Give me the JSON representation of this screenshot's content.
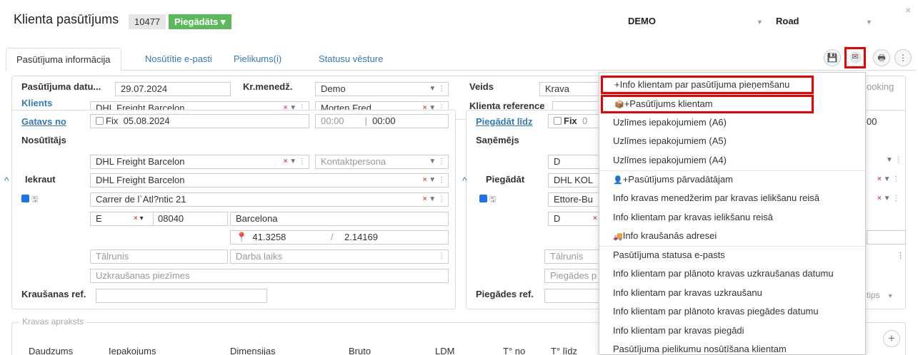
{
  "header": {
    "title": "Klienta pasūtījums",
    "order_number": "10477",
    "status": "Piegādāts ▾",
    "select1": "DEMO",
    "select2": "Road",
    "close": "×"
  },
  "tabs": [
    "Pasūtījuma informācija",
    "Nosūtītie e-pasti",
    "Pielikums(i)",
    "Statusu vēsture"
  ],
  "toolbar": {
    "save": "💾",
    "mail": "✉",
    "print": "🖶",
    "more": "⋮"
  },
  "top": {
    "date_label": "Pasūtījuma datu...",
    "date_value": "29.07.2024",
    "kr_label": "Kr.menedž.",
    "kr_value": "Demo",
    "veids_label": "Veids",
    "veids_value": "Krava",
    "client_label": "Klients",
    "client_value": "DHL Freight Barcelon",
    "contact_value": "Morten Fred",
    "client_ref_label": "Klienta reference",
    "booking_fragment": "ooking"
  },
  "pickup": {
    "gatavs_label": "Gatavs no",
    "fix": "Fix",
    "date": "05.08.2024",
    "time_from": "00:00",
    "time_sep": "|",
    "time_to": "00:00",
    "sender_label": "Nosūtītājs",
    "sender_value": "DHL Freight Barcelon",
    "contact_ph": "Kontaktpersona",
    "load_label": "Iekraut",
    "load_value": "DHL Freight Barcelon",
    "address": "Carrer de l`Atl?ntic 21",
    "country": "E",
    "postcode": "08040",
    "city": "Barcelona",
    "lat": "41.3258",
    "slash": "/",
    "lon": "2.14169",
    "phone_ph": "Tālrunis",
    "hours_ph": "Darba laiks",
    "notes_ph": "Uzkraušanas piezīmes",
    "ref_label": "Kraušanas ref."
  },
  "delivery": {
    "label": "Piegādāt līdz",
    "fix": "Fix",
    "date_frag": "0",
    "receiver_label": "Saņēmējs",
    "receiver_value": "D",
    "deliver_label": "Piegādāt",
    "deliver_value": "DHL KOL",
    "address_value": "Ettore-Bu",
    "country": "D",
    "phone_ph": "Tālrunis",
    "notes_ph": "Piegādes p",
    "ref_label": "Piegādes ref.",
    "time_frag": "00",
    "tips_frag": "tips"
  },
  "cargo": {
    "legend": "Kravas apraksts",
    "columns": [
      "Daudzums",
      "Iepakojums",
      "Dimensijas",
      "Bruto",
      "LDM",
      "T° no",
      "T° līdz"
    ],
    "add": "+"
  },
  "menu": {
    "items": [
      "+Info klientam par pasūtījuma pieņemšanu",
      "+Pasūtījums klientam",
      "Uzlīmes iepakojumiem (A6)",
      "Uzlīmes iepakojumiem (A5)",
      "Uzlīmes iepakojumiem (A4)",
      "+Pasūtījums pārvadātājam",
      "Info kravas menedžerim par kravas ielikšanu reisā",
      "Info klientam par kravas ielikšanu reisā",
      "Info kraušanās adresei",
      "Pasūtījuma statusa e-pasts",
      "Info klientam par plānoto kravas uzkraušanas datumu",
      "Info klientam par kravas uzkraušanu",
      "Info klientam par plānoto kravas piegādes datumu",
      "Info klientam par kravas piegādi",
      "Pasūtījuma pielikumu nosūtīšana klientam"
    ],
    "icons": {
      "order_client": "📦",
      "carrier": "👤",
      "loading": "🚚"
    }
  }
}
